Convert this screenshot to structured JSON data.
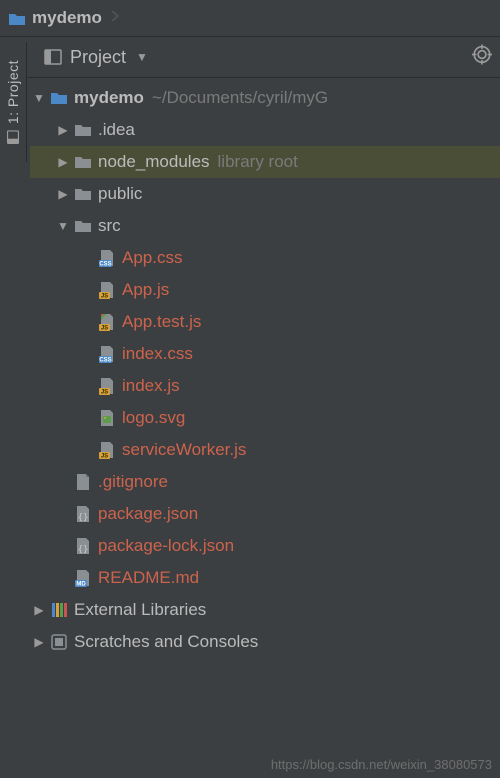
{
  "breadcrumb": {
    "name": "mydemo"
  },
  "toolbar": {
    "view_label": "Project"
  },
  "sidetab": {
    "label": "1: Project"
  },
  "tree": {
    "root": {
      "name": "mydemo",
      "hint": "~/Documents/cyril/myG"
    },
    "idea": {
      "name": ".idea"
    },
    "node_modules": {
      "name": "node_modules",
      "hint": "library root"
    },
    "public": {
      "name": "public"
    },
    "src": {
      "name": "src"
    },
    "src_files": {
      "app_css": "App.css",
      "app_js": "App.js",
      "app_test": "App.test.js",
      "index_css": "index.css",
      "index_js": "index.js",
      "logo_svg": "logo.svg",
      "sw_js": "serviceWorker.js"
    },
    "gitignore": ".gitignore",
    "package": "package.json",
    "package_lock": "package-lock.json",
    "readme": "README.md",
    "ext_lib": "External Libraries",
    "scratches": "Scratches and Consoles"
  },
  "watermark": "https://blog.csdn.net/weixin_38080573"
}
